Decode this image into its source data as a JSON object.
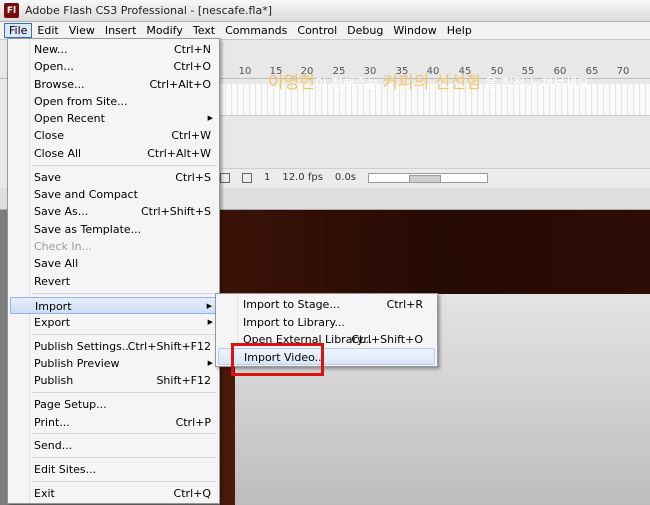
{
  "window": {
    "logo": "Fl",
    "title": "Adobe Flash CS3 Professional - [nescafe.fla*]"
  },
  "menubar": [
    "File",
    "Edit",
    "View",
    "Insert",
    "Modify",
    "Text",
    "Commands",
    "Control",
    "Debug",
    "Window",
    "Help"
  ],
  "timeline": {
    "ruler": [
      "10",
      "15",
      "20",
      "25",
      "30",
      "35",
      "40",
      "45",
      "50",
      "55",
      "60",
      "65",
      "70"
    ],
    "frame": "1",
    "fps": "12.0 fps",
    "time": "0.0s",
    "scroll_label": "III"
  },
  "banner": {
    "name": "이영헌",
    "part1": "이 전해주는",
    "highlight": "커피의 신선함",
    "part2": "을 직접 느껴보세요"
  },
  "file_menu": [
    {
      "label": "New...",
      "shortcut": "Ctrl+N"
    },
    {
      "label": "Open...",
      "shortcut": "Ctrl+O"
    },
    {
      "label": "Browse...",
      "shortcut": "Ctrl+Alt+O"
    },
    {
      "label": "Open from Site...",
      "shortcut": ""
    },
    {
      "label": "Open Recent",
      "shortcut": ""
    },
    {
      "label": "Close",
      "shortcut": "Ctrl+W"
    },
    {
      "label": "Close All",
      "shortcut": "Ctrl+Alt+W"
    },
    {
      "label": "Save",
      "shortcut": "Ctrl+S"
    },
    {
      "label": "Save and Compact",
      "shortcut": ""
    },
    {
      "label": "Save As...",
      "shortcut": "Ctrl+Shift+S"
    },
    {
      "label": "Save as Template...",
      "shortcut": ""
    },
    {
      "label": "Check In...",
      "shortcut": ""
    },
    {
      "label": "Save All",
      "shortcut": ""
    },
    {
      "label": "Revert",
      "shortcut": ""
    },
    {
      "label": "Import",
      "shortcut": ""
    },
    {
      "label": "Export",
      "shortcut": ""
    },
    {
      "label": "Publish Settings...",
      "shortcut": "Ctrl+Shift+F12"
    },
    {
      "label": "Publish Preview",
      "shortcut": ""
    },
    {
      "label": "Publish",
      "shortcut": "Shift+F12"
    },
    {
      "label": "Page Setup...",
      "shortcut": ""
    },
    {
      "label": "Print...",
      "shortcut": "Ctrl+P"
    },
    {
      "label": "Send...",
      "shortcut": ""
    },
    {
      "label": "Edit Sites...",
      "shortcut": ""
    },
    {
      "label": "Exit",
      "shortcut": "Ctrl+Q"
    }
  ],
  "import_menu": [
    {
      "label": "Import to Stage...",
      "shortcut": "Ctrl+R"
    },
    {
      "label": "Import to Library...",
      "shortcut": ""
    },
    {
      "label": "Open External Library...",
      "shortcut": "Ctrl+Shift+O"
    },
    {
      "label": "Import Video...",
      "shortcut": ""
    }
  ]
}
